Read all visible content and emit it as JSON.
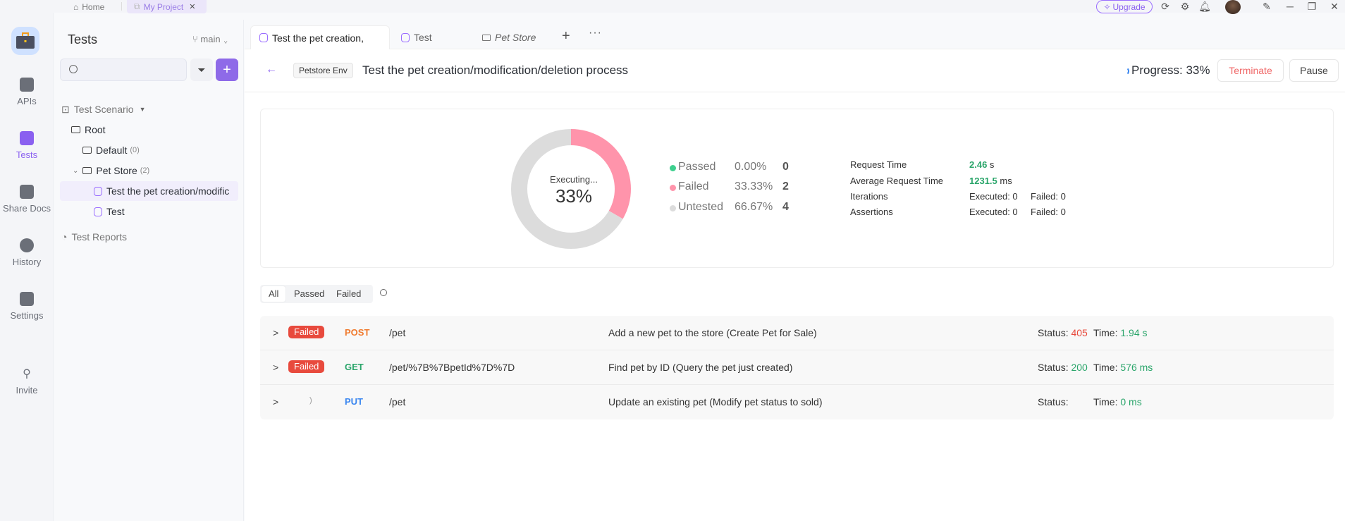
{
  "titlebar": {
    "home_label": "Home",
    "project_tab": "My Project",
    "upgrade_label": "Upgrade"
  },
  "rail": {
    "items": [
      {
        "label": "APIs",
        "icon": "api-icon"
      },
      {
        "label": "Tests",
        "icon": "tests-icon",
        "active": true
      },
      {
        "label": "Share Docs",
        "icon": "share-docs-icon"
      },
      {
        "label": "History",
        "icon": "history-icon"
      },
      {
        "label": "Settings",
        "icon": "settings-icon"
      },
      {
        "label": "Invite",
        "icon": "invite-icon"
      }
    ]
  },
  "tree": {
    "title": "Tests",
    "branch": "main",
    "search_placeholder": "",
    "items": [
      {
        "label": "Test Scenario",
        "type": "section"
      },
      {
        "label": "Root",
        "type": "folder"
      },
      {
        "label": "Default",
        "count": "(0)",
        "type": "folder"
      },
      {
        "label": "Pet Store",
        "count": "(2)",
        "type": "folder"
      },
      {
        "label": "Test the pet creation/modific",
        "type": "test",
        "selected": true
      },
      {
        "label": "Test",
        "type": "test"
      },
      {
        "label": "Test Reports",
        "type": "section"
      }
    ]
  },
  "tabs": [
    {
      "label": "Test the pet creation,",
      "active": true
    },
    {
      "label": "Test"
    },
    {
      "label": "Pet Store",
      "italic": true
    }
  ],
  "header": {
    "env": "Petstore Env",
    "title": "Test the pet creation/modification/deletion process",
    "progress": "Progress: 33%",
    "terminate": "Terminate",
    "pause": "Pause"
  },
  "summary": {
    "center_label": "Executing...",
    "center_value": "33%",
    "legend": [
      {
        "name": "Passed",
        "percent": "0.00%",
        "count": "0",
        "color": "#3ecf8e"
      },
      {
        "name": "Failed",
        "percent": "33.33%",
        "count": "2",
        "color": "#ff94ab"
      },
      {
        "name": "Untested",
        "percent": "66.67%",
        "count": "4",
        "color": "#dcdcdc"
      }
    ],
    "metrics": [
      {
        "label": "Request Time",
        "value": "2.46",
        "unit": " s"
      },
      {
        "label": "Average Request Time",
        "value": "1231.5",
        "unit": " ms"
      },
      {
        "label": "Iterations",
        "executed": "Executed: 0",
        "failed": "Failed: 0"
      },
      {
        "label": "Assertions",
        "executed": "Executed: 0",
        "failed": "Failed: 0"
      }
    ]
  },
  "chart_data": {
    "type": "pie",
    "title": "Executing... 33%",
    "categories": [
      "Passed",
      "Failed",
      "Untested"
    ],
    "values": [
      0,
      33.33,
      66.67
    ],
    "counts": [
      0,
      2,
      4
    ],
    "colors": [
      "#3ecf8e",
      "#ff94ab",
      "#dcdcdc"
    ]
  },
  "filters": [
    "All",
    "Passed",
    "Failed"
  ],
  "results": [
    {
      "badge": "Failed",
      "method": "POST",
      "method_color": "#f07a2e",
      "path": "/pet",
      "desc": "Add a new pet to the store (Create Pet for Sale)",
      "status_label": "Status:",
      "status": "405",
      "status_color": "red",
      "time_label": "Time:",
      "time": "1.94 s"
    },
    {
      "badge": "Failed",
      "method": "GET",
      "method_color": "#2aa56a",
      "path": "/pet/%7B%7BpetId%7D%7D",
      "desc": "Find pet by ID (Query the pet just created)",
      "status_label": "Status:",
      "status": "200",
      "status_color": "green",
      "time_label": "Time:",
      "time": "576 ms"
    },
    {
      "badge": "",
      "method": "PUT",
      "method_color": "#3a86f0",
      "path": "/pet",
      "desc": "Update an existing pet (Modify pet status to sold)",
      "status_label": "Status:",
      "status": "",
      "status_color": "",
      "time_label": "Time:",
      "time": "0 ms"
    }
  ]
}
